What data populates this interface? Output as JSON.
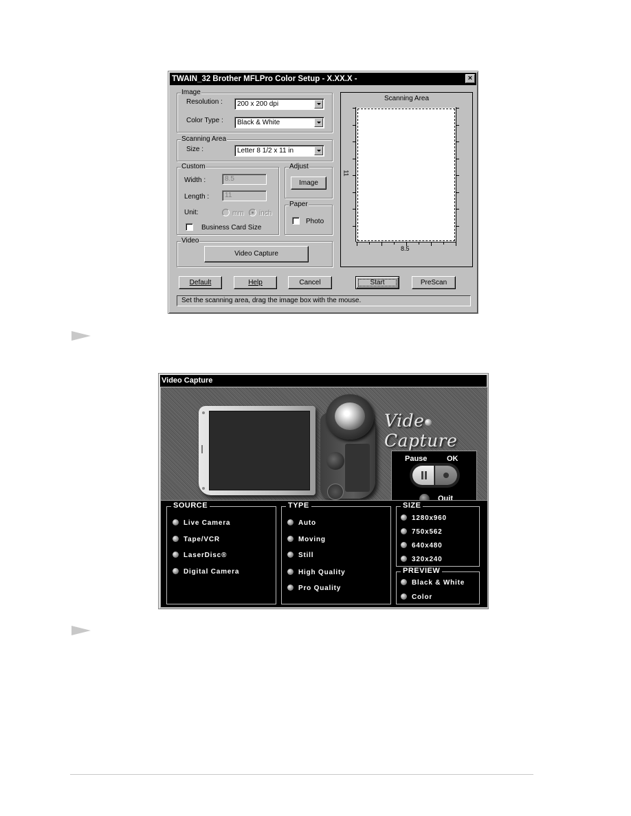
{
  "twain_dialog": {
    "title": "TWAIN_32 Brother MFLPro Color Setup - X.XX.X -",
    "close_label": "×",
    "image_group": {
      "label": "Image",
      "resolution_label": "Resolution :",
      "resolution_value": "200 x 200 dpi",
      "color_type_label": "Color Type :",
      "color_type_value": "Black & White"
    },
    "scanning_area_group": {
      "label": "Scanning Area",
      "size_label": "Size :",
      "size_value": "Letter 8 1/2 x 11 in"
    },
    "custom_group": {
      "label": "Custom",
      "width_label": "Width :",
      "width_value": "8.5",
      "length_label": "Length :",
      "length_value": "11",
      "unit_label": "Unit:",
      "unit_mm_label": "mm",
      "unit_inch_label": "inch",
      "unit_selected": "inch",
      "business_card_label": "Business Card Size",
      "business_card_checked": false
    },
    "adjust_group": {
      "label": "Adjust",
      "image_button": "Image"
    },
    "paper_group": {
      "label": "Paper",
      "photo_label": "Photo",
      "photo_checked": false
    },
    "video_group": {
      "label": "Video",
      "video_capture_button": "Video Capture"
    },
    "scan_preview": {
      "title": "Scanning Area",
      "width_readout": "8.5",
      "height_readout": "11"
    },
    "buttons": {
      "default": "Default",
      "help": "Help",
      "cancel": "Cancel",
      "start": "Start",
      "prescan": "PreScan"
    },
    "status_text": "Set the scanning area, drag the image box with the mouse."
  },
  "video_capture": {
    "title": "Video Capture",
    "logo_left": "Vide",
    "logo_right": "Capture",
    "controls": {
      "pause_label": "Pause",
      "ok_label": "OK",
      "quit_label": "Quit"
    },
    "source": {
      "label": "SOURCE",
      "options": [
        "Live Camera",
        "Tape/VCR",
        "LaserDisc®",
        "Digital Camera"
      ]
    },
    "type": {
      "label": "TYPE",
      "options": [
        "Auto",
        "Moving",
        "Still",
        "High Quality",
        "Pro Quality"
      ]
    },
    "size": {
      "label": "SIZE",
      "options": [
        "1280x960",
        "750x562",
        "640x480",
        "320x240"
      ]
    },
    "preview": {
      "label": "PREVIEW",
      "options": [
        "Black & White",
        "Color"
      ]
    }
  }
}
